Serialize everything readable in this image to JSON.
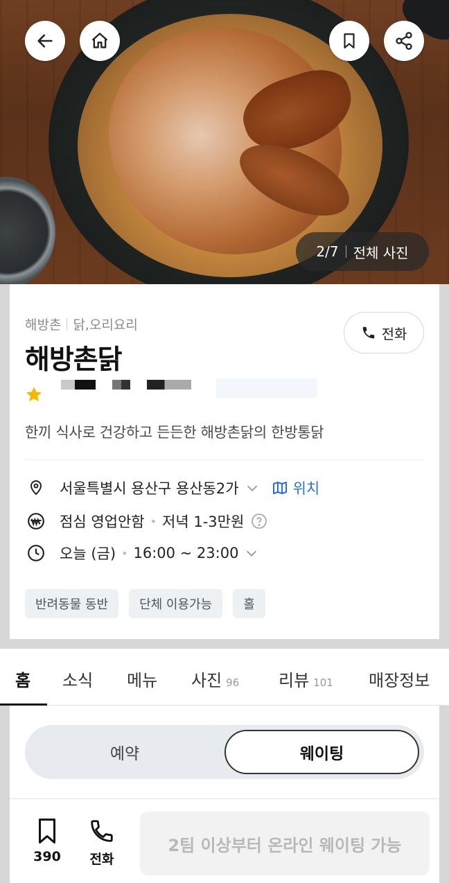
{
  "hero": {
    "photo_index": "2/7",
    "all_photos_label": "전체 사진"
  },
  "store": {
    "region_tag": "해방촌",
    "category": "닭,오리요리",
    "name": "해방촌닭",
    "call_label": "전화",
    "description": "한끼 식사로 건강하고 든든한 해방촌닭의 한방통닭",
    "address": "서울특별시 용산구 용산동2가",
    "map_label": "위치",
    "lunch": "점심 영업안함",
    "dinner_price": "저녁 1-3만원",
    "hours_day": "오늘 (금)",
    "hours": "16:00 ~ 23:00",
    "tags": [
      "반려동물 동반",
      "단체 이용가능",
      "홀"
    ]
  },
  "tabs": [
    {
      "label": "홈",
      "count": ""
    },
    {
      "label": "소식",
      "count": ""
    },
    {
      "label": "메뉴",
      "count": ""
    },
    {
      "label": "사진",
      "count": "96"
    },
    {
      "label": "리뷰",
      "count": "101"
    },
    {
      "label": "매장정보",
      "count": ""
    }
  ],
  "segment": {
    "left_label": "예약",
    "right_label": "웨이팅"
  },
  "bottom": {
    "save_count": "390",
    "call_label": "전화",
    "cta_label": "2팀 이상부터 온라인 웨이팅 가능"
  },
  "colors": {
    "accent_blue": "#2c6fd3",
    "star_yellow": "#f5b800"
  }
}
